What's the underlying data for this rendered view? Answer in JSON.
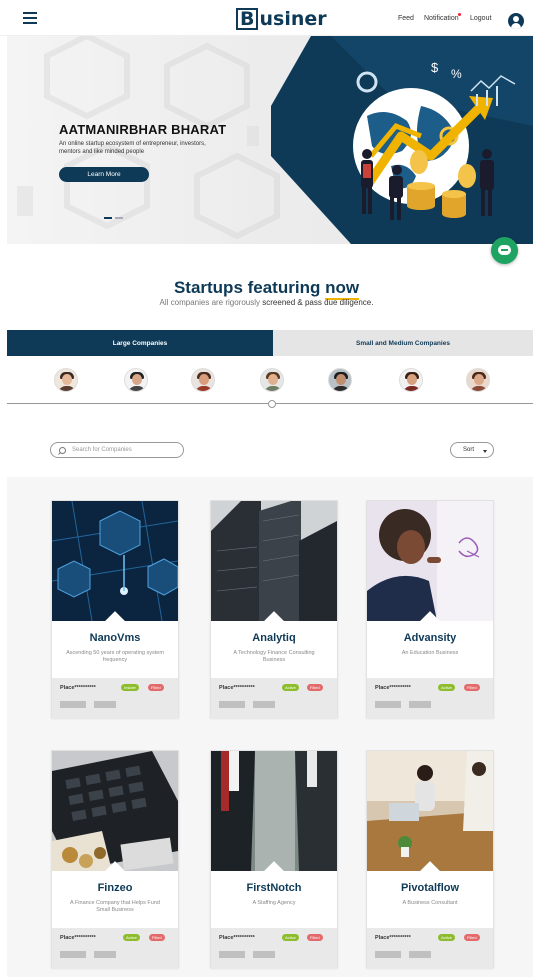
{
  "header": {
    "logo_letter": "B",
    "logo_rest": "usiner",
    "links": [
      "Feed",
      "Notification",
      "Logout"
    ]
  },
  "hero": {
    "title": "AATMANIRBHAR BHARAT",
    "subtitle": "An online startup ecosystem of entrepreneur, investors, mentors and like minded people",
    "cta": "Learn More",
    "art_symbols": [
      "$",
      "%"
    ],
    "carousel_active_index": 0
  },
  "section": {
    "title_main": "Startups featuring ",
    "title_highlight": "now",
    "subtitle_pre": "All companies are rigorously ",
    "subtitle_bold": "screened & pass due diligence."
  },
  "tabs": [
    "Large Companies",
    "Small and Medium Companies"
  ],
  "search": {
    "placeholder": "Search for Companies"
  },
  "sort": {
    "label": "Sort"
  },
  "companies": [
    {
      "name": "NanoVms",
      "desc": "Ascending 50 years of operating system frequency",
      "place": "Place**********",
      "badge1": "Insider",
      "badge2": "Filled"
    },
    {
      "name": "Analytiq",
      "desc": "A Technology Finance Consulting Business",
      "place": "Place**********",
      "badge1": "Active",
      "badge2": "Filled"
    },
    {
      "name": "Advansity",
      "desc": "An Education Business",
      "place": "Place**********",
      "badge1": "Active",
      "badge2": "Filled"
    },
    {
      "name": "Finzeo",
      "desc": "A Finance Company that Helps Fund Small Business",
      "place": "Place**********",
      "badge1": "Active",
      "badge2": "Filled"
    },
    {
      "name": "FirstNotch",
      "desc": "A Staffing Agency",
      "place": "Place**********",
      "badge1": "Active",
      "badge2": "Filled"
    },
    {
      "name": "Pivotalflow",
      "desc": "A Business Consultant",
      "place": "Place**********",
      "badge1": "Active",
      "badge2": "Filled"
    }
  ],
  "colors": {
    "primary": "#0e3a57",
    "accent": "#f0b400",
    "chat": "#1ea362",
    "badge_green": "#8dbd2c",
    "badge_red": "#e36a6a"
  }
}
